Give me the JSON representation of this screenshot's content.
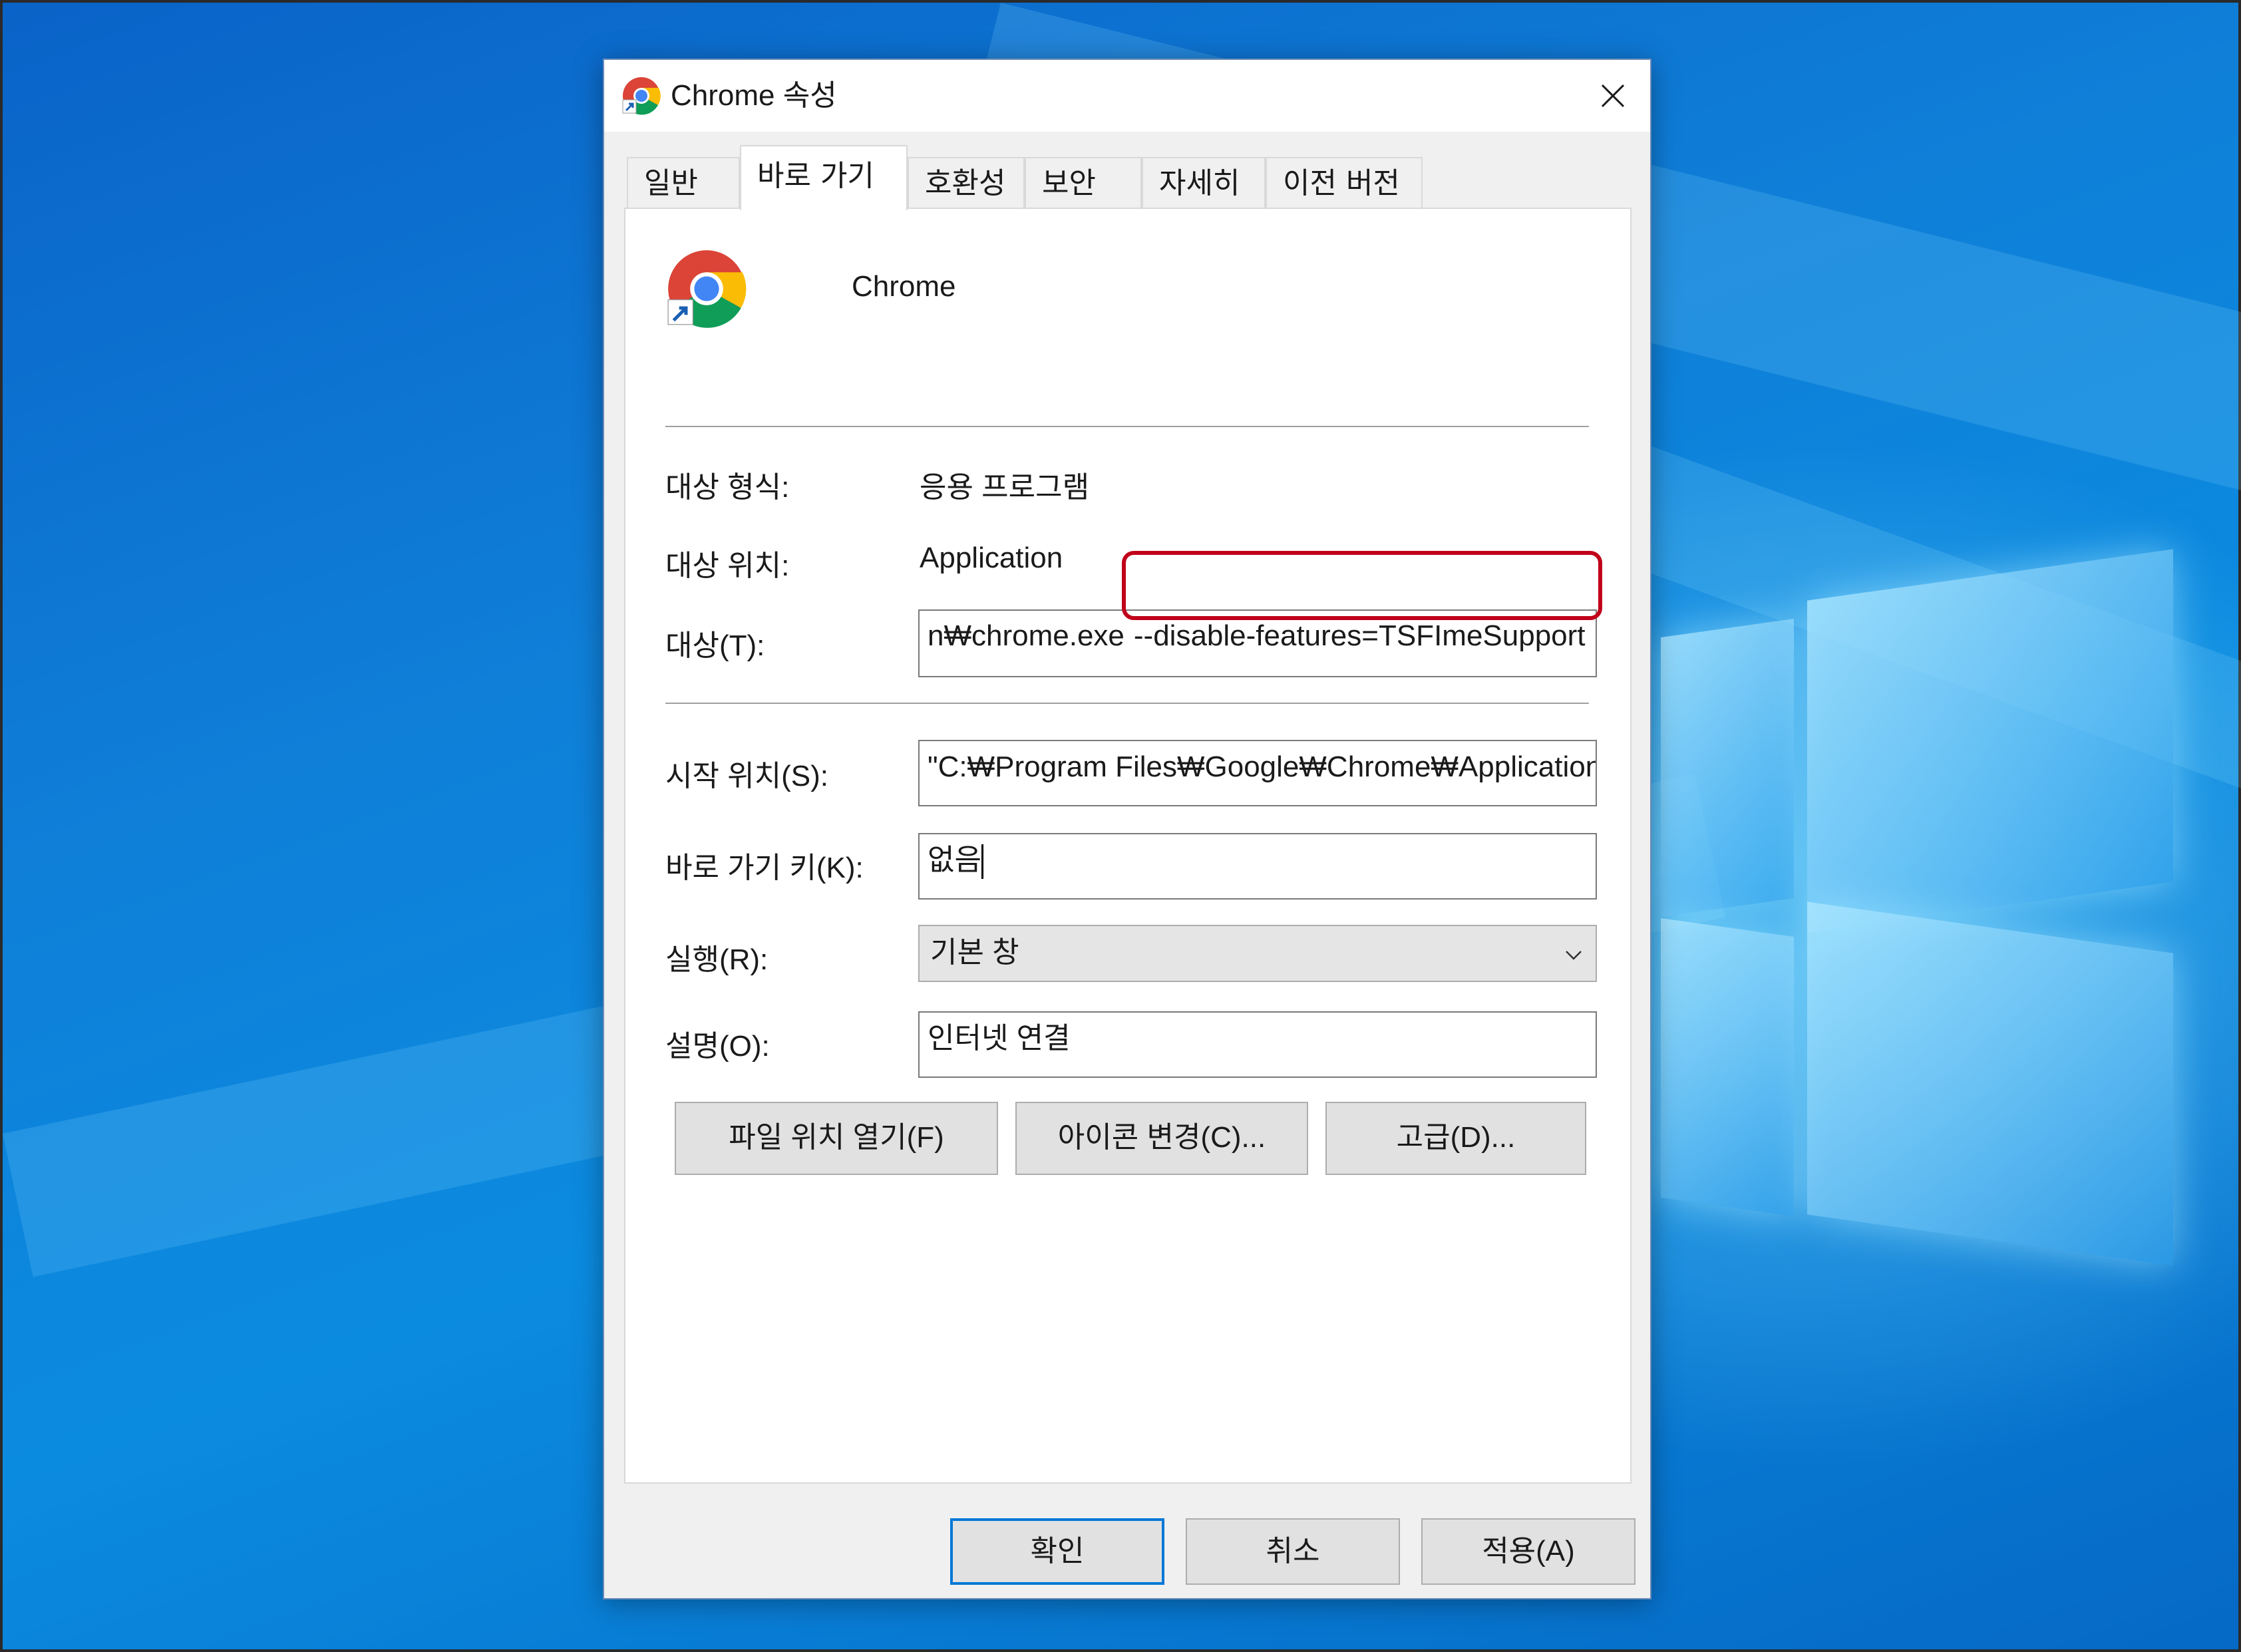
{
  "dialog": {
    "title": "Chrome 속성",
    "close_icon": "close-icon",
    "app_icon": "chrome-icon"
  },
  "tabs": [
    {
      "label": "일반",
      "active": false
    },
    {
      "label": "바로 가기",
      "active": true
    },
    {
      "label": "호환성",
      "active": false
    },
    {
      "label": "보안",
      "active": false
    },
    {
      "label": "자세히",
      "active": false
    },
    {
      "label": "이전 버전",
      "active": false
    }
  ],
  "shortcut": {
    "name": "Chrome",
    "target_type_label": "대상 형식:",
    "target_type_value": "응용 프로그램",
    "target_location_label": "대상 위치:",
    "target_location_value": "Application",
    "target_label": "대상(T):",
    "target_value_left": "n₩chrome.exe",
    "target_value_right": "--disable-features=TSFImeSupport",
    "start_in_label": "시작 위치(S):",
    "start_in_value": "\"C:₩Program Files₩Google₩Chrome₩Application\"",
    "hotkey_label": "바로 가기 키(K):",
    "hotkey_value": "없음",
    "run_label": "실행(R):",
    "run_value": "기본 창",
    "comment_label": "설명(O):",
    "comment_value": "인터넷 연결"
  },
  "actions": {
    "open_location": "파일 위치 열기(F)",
    "change_icon": "아이콘 변경(C)...",
    "advanced": "고급(D)..."
  },
  "footer": {
    "ok": "확인",
    "cancel": "취소",
    "apply": "적용(A)"
  },
  "colors": {
    "highlight": "#c0001a",
    "default_button_border": "#0078d7",
    "desktop": "#0b7bd6"
  }
}
